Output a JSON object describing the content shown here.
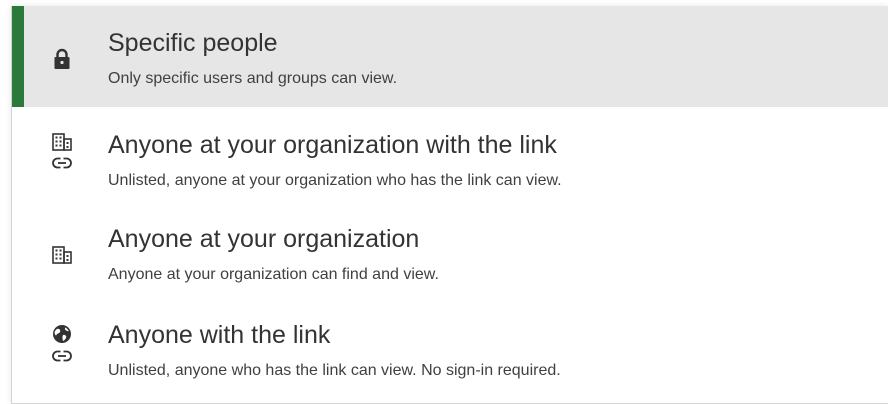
{
  "colors": {
    "selected_bg": "#e6e6e6",
    "selected_accent": "#2b7a3b",
    "icon": "#333333"
  },
  "options": [
    {
      "title": "Specific people",
      "description": "Only specific users and groups can view.",
      "icons": [
        "lock-icon"
      ],
      "selected": true
    },
    {
      "title": "Anyone at your organization with the link",
      "description": "Unlisted, anyone at your organization who has the link can view.",
      "icons": [
        "building-icon",
        "link-icon"
      ],
      "selected": false
    },
    {
      "title": "Anyone at your organization",
      "description": "Anyone at your organization can find and view.",
      "icons": [
        "building-icon"
      ],
      "selected": false
    },
    {
      "title": "Anyone with the link",
      "description": "Unlisted, anyone who has the link can view. No sign-in required.",
      "icons": [
        "globe-icon",
        "link-icon"
      ],
      "selected": false
    }
  ]
}
